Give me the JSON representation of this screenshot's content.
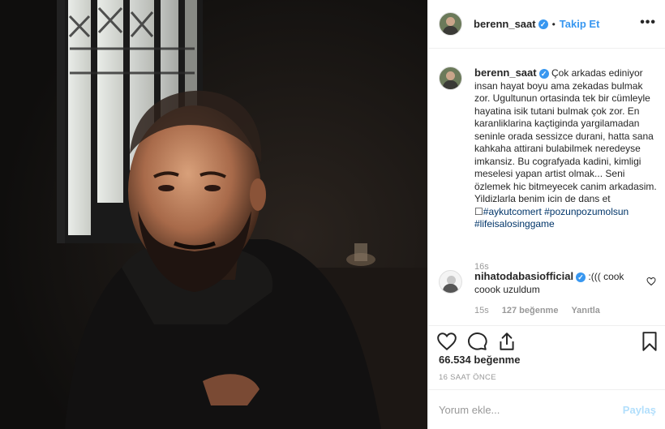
{
  "post": {
    "author": "berenn_saat",
    "follow_label": "Takip Et",
    "dot": "•",
    "more": "•••",
    "verified_glyph": "✓"
  },
  "caption": {
    "author": "berenn_saat",
    "text": "Çok arkadas ediniyor insan hayat boyu ama zekadas bulmak zor. Ugultunun ortasinda tek bir cümleyle hayatina isik tutani bulmak çok zor. En karanliklarina kaçtiginda yargilamadan seninle orada sessizce durani, hatta sana kahkaha attirani bulabilmek neredeyse imkansiz. Bu cografyada kadini, kimligi meselesi yapan artist olmak... Seni özlemek hic bitmeyecek canim arkadasim. Yildizlarla benim icin de dans et ☐",
    "hashtags": "#aykutcomert #pozunpozumolsun #lifeisalosinggame",
    "time": "16s"
  },
  "comment": {
    "author": "nihatodabasiofficial",
    "text": ":((( cook coook uzuldum",
    "time": "15s",
    "likes": "127 beğenme",
    "reply": "Yanıtla"
  },
  "stats": {
    "likes": "66.534 beğenme",
    "time": "16 SAAT ÖNCE"
  },
  "add_comment": {
    "placeholder": "Yorum ekle...",
    "post_label": "Paylaş"
  },
  "icons": {
    "like": "heart-icon",
    "comment": "comment-icon",
    "share": "share-icon",
    "save": "bookmark-icon",
    "comment_like": "heart-icon"
  },
  "colors": {
    "link": "#3897f0",
    "hashtag": "#003569",
    "muted": "#999999",
    "post_disabled": "#b2dffc"
  }
}
